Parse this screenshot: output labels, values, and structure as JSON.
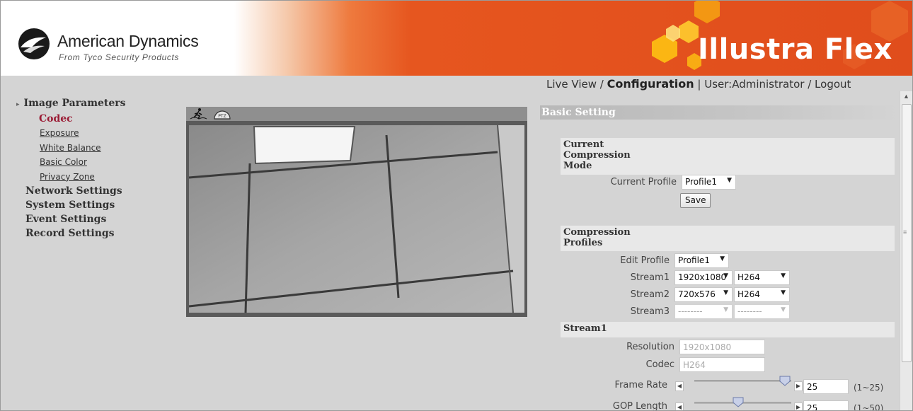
{
  "header": {
    "brand_name": "American Dynamics",
    "brand_sub": "From Tyco Security Products",
    "product_name": "Illustra Flex"
  },
  "topnav": {
    "live_view": "Live View",
    "sep1": " / ",
    "configuration": "Configuration",
    "sep2": " | ",
    "user": "User:Administrator",
    "sep3": " / ",
    "logout": "Logout"
  },
  "leftnav": {
    "image_parameters": "Image Parameters",
    "sub_items": [
      {
        "label": "Codec",
        "active": true
      },
      {
        "label": "Exposure"
      },
      {
        "label": "White Balance"
      },
      {
        "label": "Basic Color"
      },
      {
        "label": "Privacy Zone"
      }
    ],
    "network_settings": "Network Settings",
    "system_settings": "System Settings",
    "event_settings": "Event Settings",
    "record_settings": "Record Settings"
  },
  "camera": {
    "dome_label": "PTZ"
  },
  "panel": {
    "title": "Basic Setting",
    "current_mode": {
      "heading": "Current Compression Mode",
      "current_profile_label": "Current Profile",
      "current_profile_value": "Profile1",
      "save_label": "Save"
    },
    "profiles": {
      "heading": "Compression Profiles",
      "edit_profile_label": "Edit Profile",
      "edit_profile_value": "Profile1",
      "stream1_label": "Stream1",
      "stream1_res": "1920x1080",
      "stream1_codec": "H264",
      "stream2_label": "Stream2",
      "stream2_res": "720x576",
      "stream2_codec": "H264",
      "stream3_label": "Stream3",
      "stream3_res": "--------",
      "stream3_codec": "--------"
    },
    "stream1": {
      "heading": "Stream1",
      "resolution_label": "Resolution",
      "resolution_value": "1920x1080",
      "codec_label": "Codec",
      "codec_value": "H264",
      "frame_rate_label": "Frame Rate",
      "frame_rate_value": "25",
      "frame_rate_range": "(1~25)",
      "frame_rate_level": 1.0,
      "gop_label": "GOP Length",
      "gop_value": "25",
      "gop_range": "(1~50)",
      "gop_level": 0.5
    }
  },
  "colors": {
    "accent_orange": "#e04d1c",
    "active_nav": "#9b1c35"
  }
}
